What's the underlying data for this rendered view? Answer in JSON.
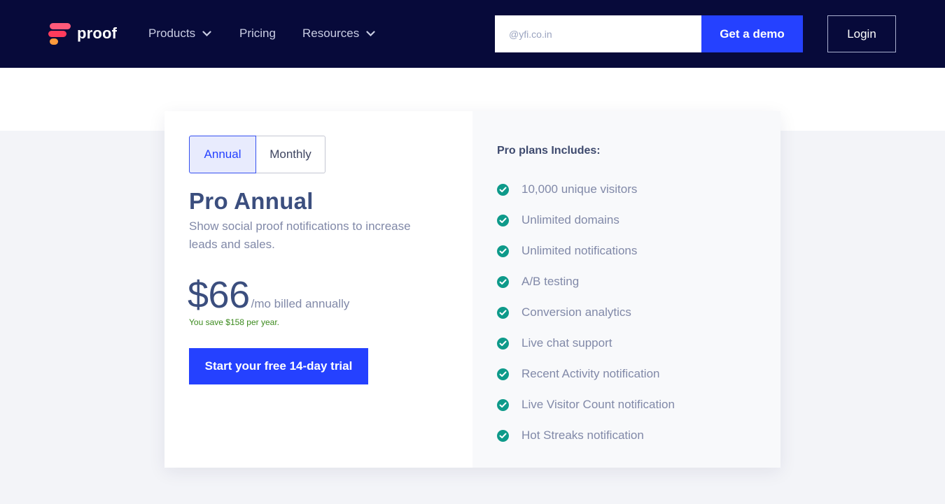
{
  "header": {
    "logo_text": "proof",
    "nav": [
      {
        "label": "Products",
        "has_dropdown": true
      },
      {
        "label": "Pricing",
        "has_dropdown": false
      },
      {
        "label": "Resources",
        "has_dropdown": true
      }
    ],
    "email_placeholder": "@yfi.co.in",
    "demo_label": "Get a demo",
    "login_label": "Login"
  },
  "plan": {
    "toggle": {
      "annual": "Annual",
      "monthly": "Monthly",
      "selected": "Annual"
    },
    "title": "Pro Annual",
    "description": "Show social proof notifications to increase leads and sales.",
    "price": "$66",
    "price_suffix": "/mo billed annually",
    "savings": "You save $158 per year.",
    "cta": "Start your free 14-day trial"
  },
  "includes": {
    "title": "Pro plans Includes:",
    "features": [
      "10,000 unique visitors",
      "Unlimited domains",
      "Unlimited notifications",
      "A/B testing",
      "Conversion analytics",
      "Live chat support",
      "Recent Activity notification",
      "Live Visitor Count notification",
      "Hot Streaks notification"
    ]
  },
  "colors": {
    "nav_bg": "#070a3a",
    "primary": "#2541ff",
    "check": "#0e9a8a",
    "heading": "#3b4e7e",
    "savings": "#3c8a1e"
  }
}
